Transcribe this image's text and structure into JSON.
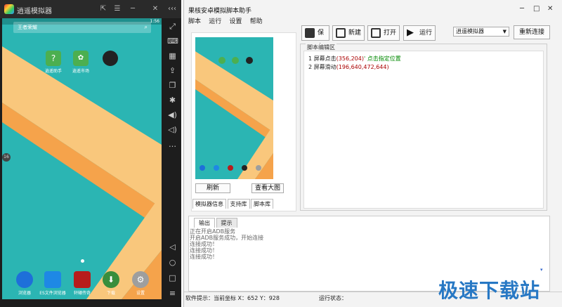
{
  "emulator": {
    "title": "逍遥模拟器",
    "controls": [
      "⇱",
      "☰",
      "─",
      "✕",
      "‹‹‹"
    ],
    "status_time": "1:56",
    "search_placeholder": "王者荣耀",
    "apps": [
      {
        "name": "逍遥助手",
        "color": "#4caf50"
      },
      {
        "name": "逍遥市场",
        "color": "#4caf50"
      },
      {
        "name": "",
        "color": "#222222"
      }
    ],
    "dock": [
      {
        "name": "浏览器",
        "color": "#1e6fd9"
      },
      {
        "name": "ES文件浏览器",
        "color": "#1e88e5"
      },
      {
        "name": "轩辕传奇",
        "color": "#b71c1c"
      },
      {
        "name": "下载",
        "color": "#388e3c"
      },
      {
        "name": "设置",
        "color": "#9e9e9e"
      }
    ],
    "page_num": "16",
    "sidebar_icons": [
      "⤢",
      "⌨",
      "▦",
      "⇪",
      "❐",
      "✱",
      "◀)",
      "◁)",
      "…",
      "◁",
      "○",
      "□",
      "≡"
    ]
  },
  "assistant": {
    "title": "果核安卓模拟脚本助手",
    "window_controls": [
      "─",
      "□",
      "✕"
    ],
    "menu": [
      "脚本",
      "运行",
      "设置",
      "帮助"
    ],
    "preview_buttons": {
      "refresh": "刷新",
      "view_large": "查看大图"
    },
    "preview_tabs": [
      "模拟器信息",
      "支持库",
      "脚本库"
    ],
    "toolbar": {
      "save": "保存",
      "new": "新建",
      "open": "打开",
      "run": "运行"
    },
    "emulator_select": "逍遥模拟器",
    "reconnect": "重新连接",
    "editor_label": "脚本编辑区",
    "script_lines": [
      {
        "num": "1",
        "cmd": "屏幕点击",
        "args": "(356,204)",
        "comment": "' 点击指定位置"
      },
      {
        "num": "2",
        "cmd": "屏幕滑动",
        "args": "(196,640,472,644)",
        "comment": ""
      }
    ],
    "output_tabs": [
      "输出",
      "提示"
    ],
    "output_log": [
      "正在开启ADB服务",
      "开启ADB服务成功，开始连接",
      "连接成功！",
      "连接成功！",
      "连接成功！"
    ],
    "status_hint": "软件提示：当前坐标 X：652 Y：928",
    "run_status": "运行状态："
  },
  "watermark": "极速下载站",
  "colors": {
    "accent": "#2778c4",
    "teal": "#2bb5b3",
    "stripe_orange": "#f5a34b",
    "stripe_light": "#f9c77c"
  }
}
